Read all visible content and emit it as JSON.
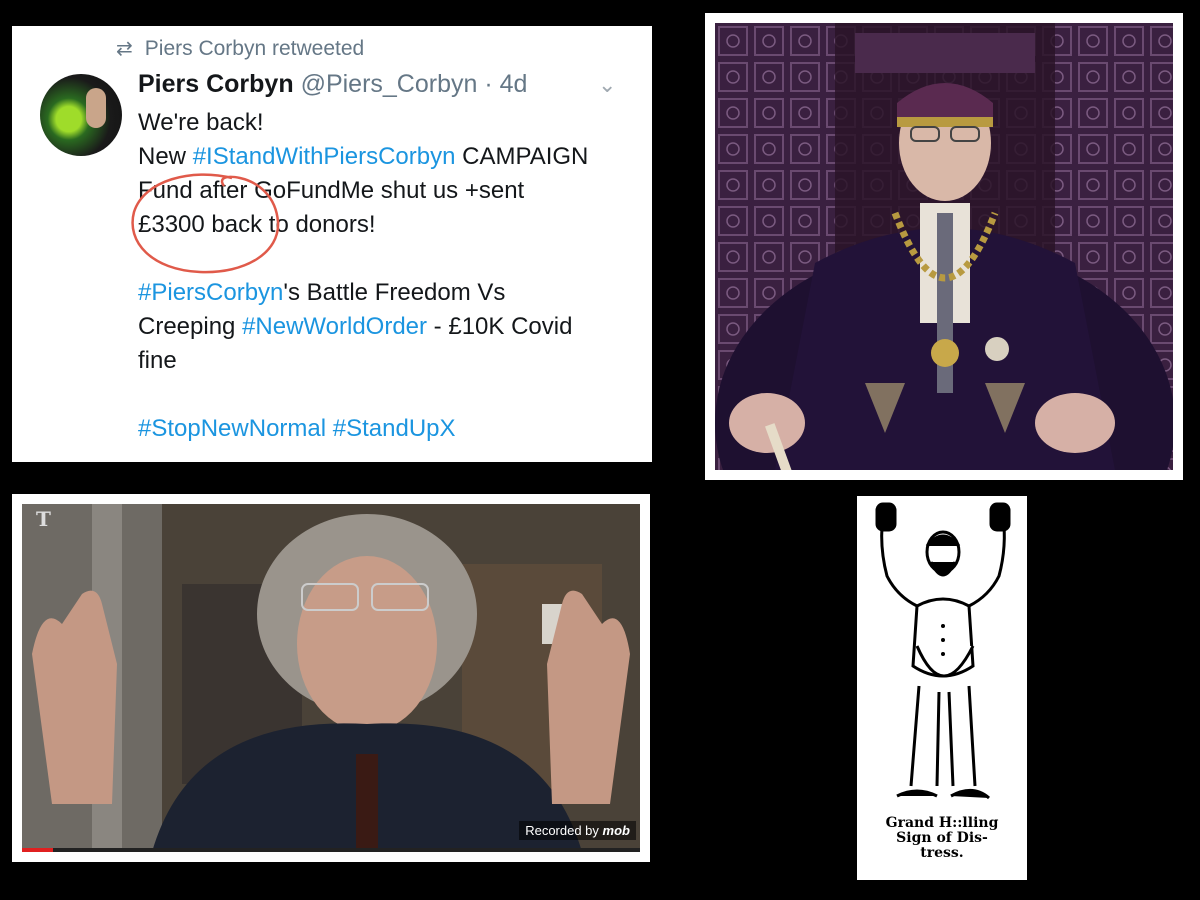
{
  "tweet": {
    "retweet_label": "Piers Corbyn retweeted",
    "name": "Piers Corbyn",
    "handle": "@Piers_Corbyn",
    "separator": "·",
    "time": "4d",
    "lines": [
      [
        {
          "t": "We're back!"
        }
      ],
      [
        {
          "t": "New "
        },
        {
          "t": "#IStandWithPiersCorbyn",
          "tag": true
        },
        {
          "t": " CAMPAIGN"
        }
      ],
      [
        {
          "t": "Fund after GoFundMe shut us +sent"
        }
      ],
      [
        {
          "t": "£3300 back to donors!"
        }
      ],
      [],
      [
        {
          "t": "#PiersCorbyn",
          "tag": true
        },
        {
          "t": "'s Battle Freedom Vs"
        }
      ],
      [
        {
          "t": "Creeping "
        },
        {
          "t": "#NewWorldOrder",
          "tag": true
        },
        {
          "t": " - £10K Covid"
        }
      ],
      [
        {
          "t": "fine"
        }
      ],
      [],
      [
        {
          "t": "#StopNewNormal",
          "tag": true
        },
        {
          "t": " "
        },
        {
          "t": "#StandUpX",
          "tag": true
        }
      ]
    ],
    "hashtag_color": "#1b95e0",
    "annotation_color": "#e05a4a"
  },
  "video": {
    "recorded_label": "Recorded by",
    "watermark_logo": "mob",
    "progress": 0.05
  },
  "engraving": {
    "caption_lines": [
      "Grand H::lling",
      "Sign of Dis-",
      "tress."
    ]
  },
  "icons": {
    "retweet": "retweet-icon",
    "chevron": "chevron-down-icon"
  }
}
